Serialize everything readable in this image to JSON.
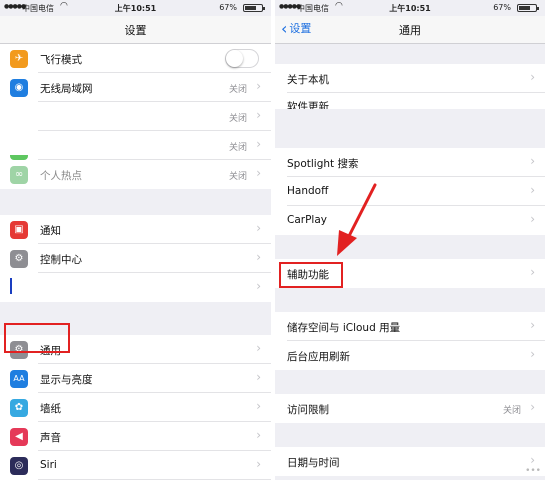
{
  "left_screen": {
    "status": {
      "carrier": "中国电信",
      "time": "上午10:51",
      "battery": "67%"
    },
    "title": "设置",
    "groups": [
      [
        {
          "label": "飞行模式",
          "icon": "airplane-icon",
          "icon_color": "#f29a1e",
          "toggle": "off"
        },
        {
          "label": "无线局域网",
          "value": "关闭",
          "icon": "wifi-icon",
          "icon_color": "#1f7ee0"
        },
        {
          "label": "",
          "value": "关闭"
        },
        {
          "label": "",
          "value": "关闭",
          "icon_color": "#5ec760"
        },
        {
          "label": "个人热点",
          "value": "关闭",
          "icon": "hotspot-icon",
          "icon_color": "#9fd4a6"
        }
      ],
      [
        {
          "label": "通知",
          "icon": "notifications-icon",
          "icon_color": "#e53935"
        },
        {
          "label": "控制中心",
          "icon": "control-center-icon",
          "icon_color": "#8e8e93"
        },
        {
          "label": ""
        }
      ],
      [
        {
          "label": "通用",
          "icon": "gear-icon",
          "icon_color": "#8e8e93"
        },
        {
          "label": "显示与亮度",
          "icon": "display-icon",
          "icon_glyph": "AA",
          "icon_color": "#1f7ee0"
        },
        {
          "label": "墙纸",
          "icon": "wallpaper-icon",
          "icon_color": "#36a9e1"
        },
        {
          "label": "声音",
          "icon": "sound-icon",
          "icon_color": "#e53958"
        },
        {
          "label": "Siri",
          "icon": "siri-icon",
          "icon_color": "#2c2c5a"
        }
      ]
    ]
  },
  "right_screen": {
    "status": {
      "carrier": "中国电信",
      "time": "上午10:51",
      "battery": "67%"
    },
    "back_label": "设置",
    "title": "通用",
    "groups": [
      [
        {
          "label": "关于本机"
        },
        {
          "label": "软件更新"
        }
      ],
      [
        {
          "label": "Spotlight 搜索"
        },
        {
          "label": "Handoff"
        },
        {
          "label": "CarPlay"
        }
      ],
      [
        {
          "label": "辅助功能"
        }
      ],
      [
        {
          "label": "储存空间与 iCloud 用量"
        },
        {
          "label": "后台应用刷新"
        }
      ],
      [
        {
          "label": "访问限制",
          "value": "关闭"
        }
      ],
      [
        {
          "label": "日期与时间"
        }
      ]
    ]
  },
  "annotations": {
    "highlight_color": "#e22121"
  }
}
